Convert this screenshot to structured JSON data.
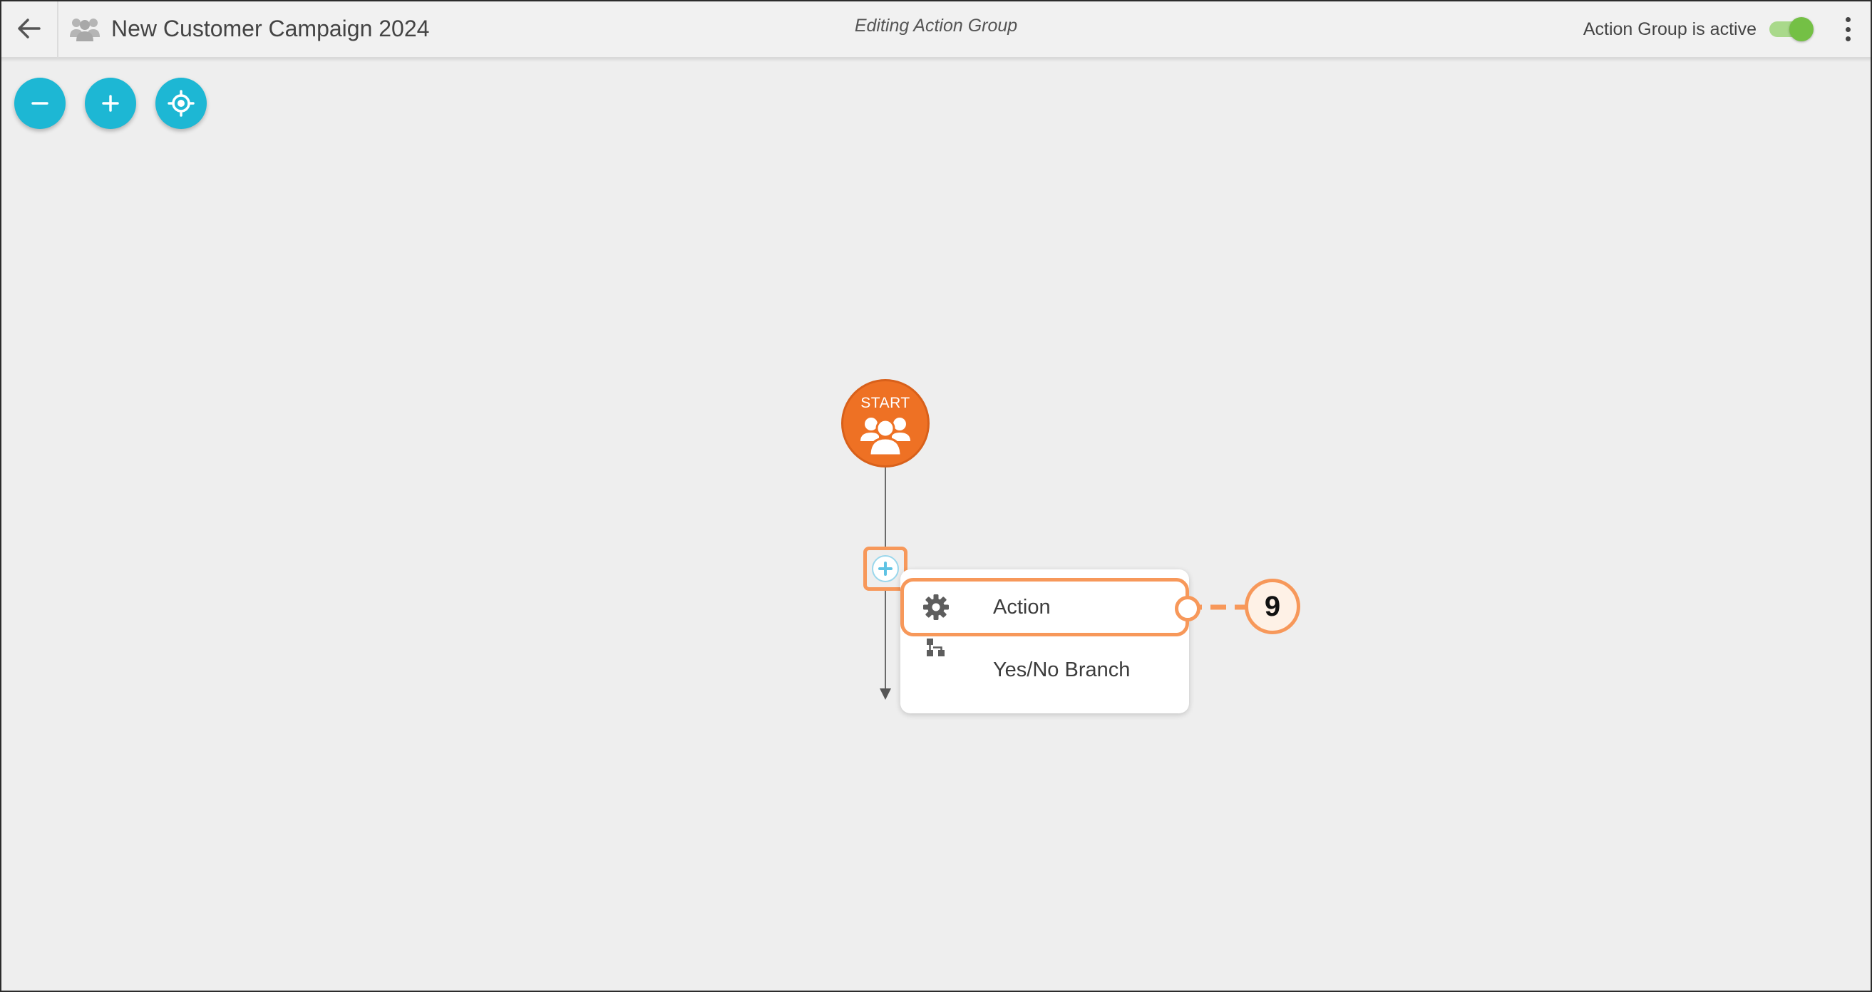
{
  "header": {
    "title": "New Customer Campaign 2024",
    "mode_label": "Editing Action Group",
    "active_label": "Action Group is active",
    "active": true,
    "icons": {
      "back": "arrow-left-icon",
      "group": "user-group-icon",
      "menu": "more-vertical-icon"
    }
  },
  "canvas_controls": [
    {
      "icon": "zoom-out-icon",
      "symbol": "minus"
    },
    {
      "icon": "zoom-in-icon",
      "symbol": "plus"
    },
    {
      "icon": "recenter-icon",
      "symbol": "target"
    }
  ],
  "flow": {
    "start_node": {
      "label": "START",
      "icon": "user-group-icon"
    },
    "add_step_icon": "plus-circle-icon"
  },
  "add_menu": {
    "items": [
      {
        "label": "Action",
        "icon": "gear-icon",
        "highlighted": true
      },
      {
        "label": "Yes/No Branch",
        "icon": "branch-icon"
      }
    ]
  },
  "callout": {
    "number": "9"
  },
  "colors": {
    "accent_fab": "#1db7d4",
    "start_node": "#ee7124",
    "highlight": "#f7985a",
    "toggle_on": "#74c045",
    "canvas_bg": "#eeeeee"
  }
}
